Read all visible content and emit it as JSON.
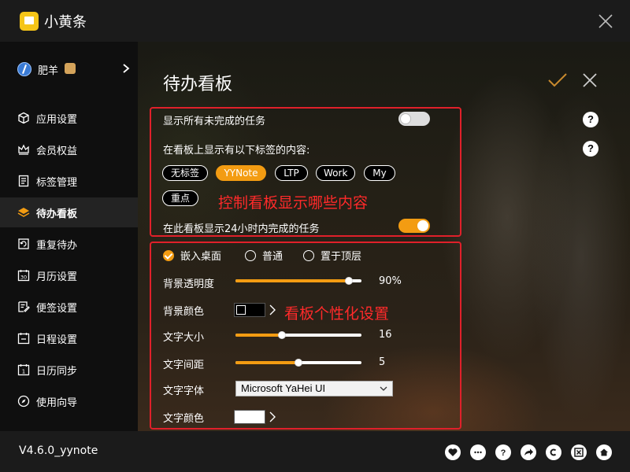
{
  "app": {
    "title": "小黄条"
  },
  "user": {
    "name": "肥羊"
  },
  "sidebar": {
    "items": [
      {
        "label": "应用设置",
        "icon": "cube-icon"
      },
      {
        "label": "会员权益",
        "icon": "crown-icon"
      },
      {
        "label": "标签管理",
        "icon": "list-icon"
      },
      {
        "label": "待办看板",
        "icon": "layers-icon",
        "active": true
      },
      {
        "label": "重复待办",
        "icon": "repeat-icon"
      },
      {
        "label": "月历设置",
        "icon": "calendar-30-icon"
      },
      {
        "label": "便签设置",
        "icon": "note-icon"
      },
      {
        "label": "日程设置",
        "icon": "schedule-icon"
      },
      {
        "label": "日历同步",
        "icon": "sync-calendar-icon"
      },
      {
        "label": "使用向导",
        "icon": "compass-icon"
      }
    ]
  },
  "main": {
    "title": "待办看板",
    "show_all_unfinished": {
      "label": "显示所有未完成的任务",
      "enabled": false
    },
    "tags_prompt": "在看板上显示有以下标签的内容:",
    "tags": [
      {
        "label": "无标签",
        "selected": false
      },
      {
        "label": "YYNote",
        "selected": true
      },
      {
        "label": "LTP",
        "selected": false
      },
      {
        "label": "Work",
        "selected": false
      },
      {
        "label": "My",
        "selected": false
      },
      {
        "label": "重点",
        "selected": false
      }
    ],
    "show_completed_24h": {
      "label": "在此看板显示24小时内完成的任务",
      "enabled": true
    },
    "annotation_top": "控制看板显示哪些内容",
    "annotation_bottom": "看板个性化设置",
    "window_modes": [
      {
        "label": "嵌入桌面",
        "checked": true
      },
      {
        "label": "普通",
        "checked": false
      },
      {
        "label": "置于顶层",
        "checked": false
      }
    ],
    "opacity": {
      "label": "背景透明度",
      "value_text": "90%",
      "fraction": 0.9
    },
    "bg_color": {
      "label": "背景颜色",
      "color": "#000000"
    },
    "font_size": {
      "label": "文字大小",
      "value_text": "16",
      "fraction": 0.37
    },
    "letter_spacing": {
      "label": "文字间距",
      "value_text": "5",
      "fraction": 0.5
    },
    "font_family": {
      "label": "文字字体",
      "value": "Microsoft YaHei UI"
    },
    "text_color": {
      "label": "文字颜色",
      "color": "#ffffff"
    }
  },
  "footer": {
    "version": "V4.6.0_yynote"
  },
  "colors": {
    "accent": "#f39c12",
    "annotation": "#e0202a"
  }
}
